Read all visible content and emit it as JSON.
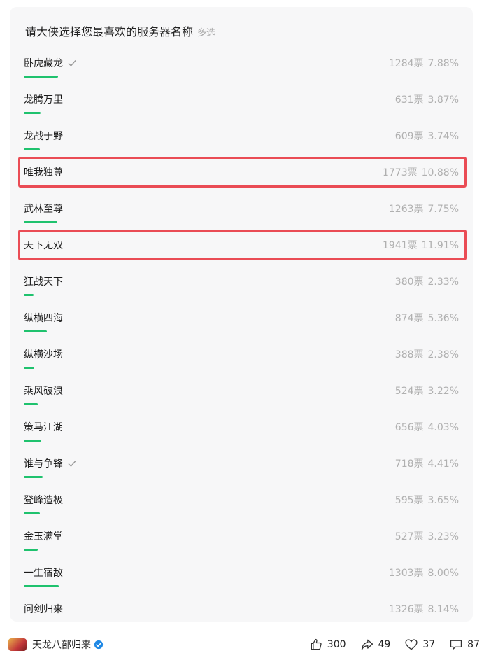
{
  "poll": {
    "title": "请大侠选择您最喜欢的服务器名称",
    "type": "多选",
    "options": [
      {
        "label": "卧虎藏龙",
        "votes": "1284票",
        "percent": "7.88%",
        "fraction": 0.0788,
        "checked": true,
        "highlighted": false
      },
      {
        "label": "龙腾万里",
        "votes": "631票",
        "percent": "3.87%",
        "fraction": 0.0387,
        "checked": false,
        "highlighted": false
      },
      {
        "label": "龙战于野",
        "votes": "609票",
        "percent": "3.74%",
        "fraction": 0.0374,
        "checked": false,
        "highlighted": false
      },
      {
        "label": "唯我独尊",
        "votes": "1773票",
        "percent": "10.88%",
        "fraction": 0.1088,
        "checked": false,
        "highlighted": true
      },
      {
        "label": "武林至尊",
        "votes": "1263票",
        "percent": "7.75%",
        "fraction": 0.0775,
        "checked": false,
        "highlighted": false
      },
      {
        "label": "天下无双",
        "votes": "1941票",
        "percent": "11.91%",
        "fraction": 0.1191,
        "checked": false,
        "highlighted": true
      },
      {
        "label": "狂战天下",
        "votes": "380票",
        "percent": "2.33%",
        "fraction": 0.0233,
        "checked": false,
        "highlighted": false
      },
      {
        "label": "纵横四海",
        "votes": "874票",
        "percent": "5.36%",
        "fraction": 0.0536,
        "checked": false,
        "highlighted": false
      },
      {
        "label": "纵横沙场",
        "votes": "388票",
        "percent": "2.38%",
        "fraction": 0.0238,
        "checked": false,
        "highlighted": false
      },
      {
        "label": "乘风破浪",
        "votes": "524票",
        "percent": "3.22%",
        "fraction": 0.0322,
        "checked": false,
        "highlighted": false
      },
      {
        "label": "策马江湖",
        "votes": "656票",
        "percent": "4.03%",
        "fraction": 0.0403,
        "checked": false,
        "highlighted": false
      },
      {
        "label": "谁与争锋",
        "votes": "718票",
        "percent": "4.41%",
        "fraction": 0.0441,
        "checked": true,
        "highlighted": false
      },
      {
        "label": "登峰造极",
        "votes": "595票",
        "percent": "3.65%",
        "fraction": 0.0365,
        "checked": false,
        "highlighted": false
      },
      {
        "label": "金玉满堂",
        "votes": "527票",
        "percent": "3.23%",
        "fraction": 0.0323,
        "checked": false,
        "highlighted": false
      },
      {
        "label": "一生宿敌",
        "votes": "1303票",
        "percent": "8.00%",
        "fraction": 0.08,
        "checked": false,
        "highlighted": false
      },
      {
        "label": "问剑归来",
        "votes": "1326票",
        "percent": "8.14%",
        "fraction": 0.0814,
        "checked": false,
        "highlighted": false
      }
    ],
    "bar_color": "#1fc26e",
    "highlight_color": "#ea4c55"
  },
  "footer": {
    "author_name": "天龙八部归来",
    "likes": "300",
    "shares": "49",
    "favorites": "37",
    "comments": "87"
  },
  "icons": {
    "check": "check-icon",
    "verified": "verified-badge-icon",
    "like": "thumbs-up-icon",
    "share": "share-arrow-icon",
    "favorite": "heart-icon",
    "comment": "comment-bubble-icon"
  }
}
